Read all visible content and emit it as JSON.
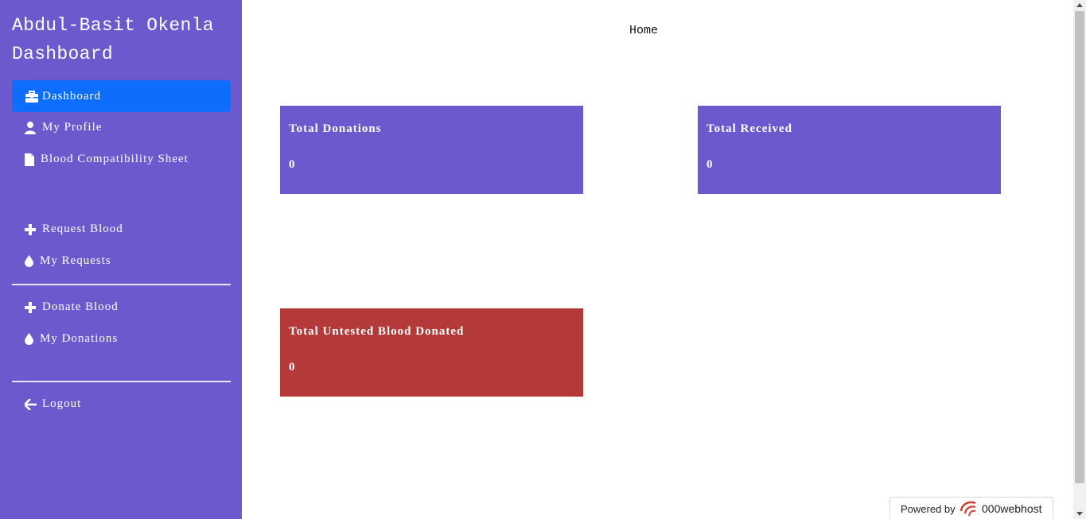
{
  "sidebar": {
    "brand_line1": "Abdul-Basit Okenla",
    "brand_line2": "Dashboard",
    "items": [
      {
        "label": "Dashboard",
        "icon": "briefcase-icon"
      },
      {
        "label": "My Profile",
        "icon": "user-icon"
      },
      {
        "label": "Blood Compatibility Sheet",
        "icon": "file-icon"
      },
      {
        "label": "Request Blood",
        "icon": "plus-icon"
      },
      {
        "label": "My Requests",
        "icon": "droplet-icon"
      },
      {
        "label": "Donate Blood",
        "icon": "plus-icon"
      },
      {
        "label": "My Donations",
        "icon": "droplet-icon"
      },
      {
        "label": "Logout",
        "icon": "arrow-left-icon"
      }
    ]
  },
  "topnav": {
    "home_label": "Home"
  },
  "cards": [
    {
      "title": "Total Donations",
      "value": "0",
      "color": "#6a5acd"
    },
    {
      "title": "Total Received",
      "value": "0",
      "color": "#6a5acd"
    },
    {
      "title": "Total Untested Blood Donated",
      "value": "0",
      "color": "#b43a3a"
    }
  ],
  "badge": {
    "label": "Powered by",
    "brand": "000webhost"
  },
  "colors": {
    "sidebar_bg": "#6a5acd",
    "active_item": "#0d6efd",
    "danger_card": "#b43a3a"
  }
}
